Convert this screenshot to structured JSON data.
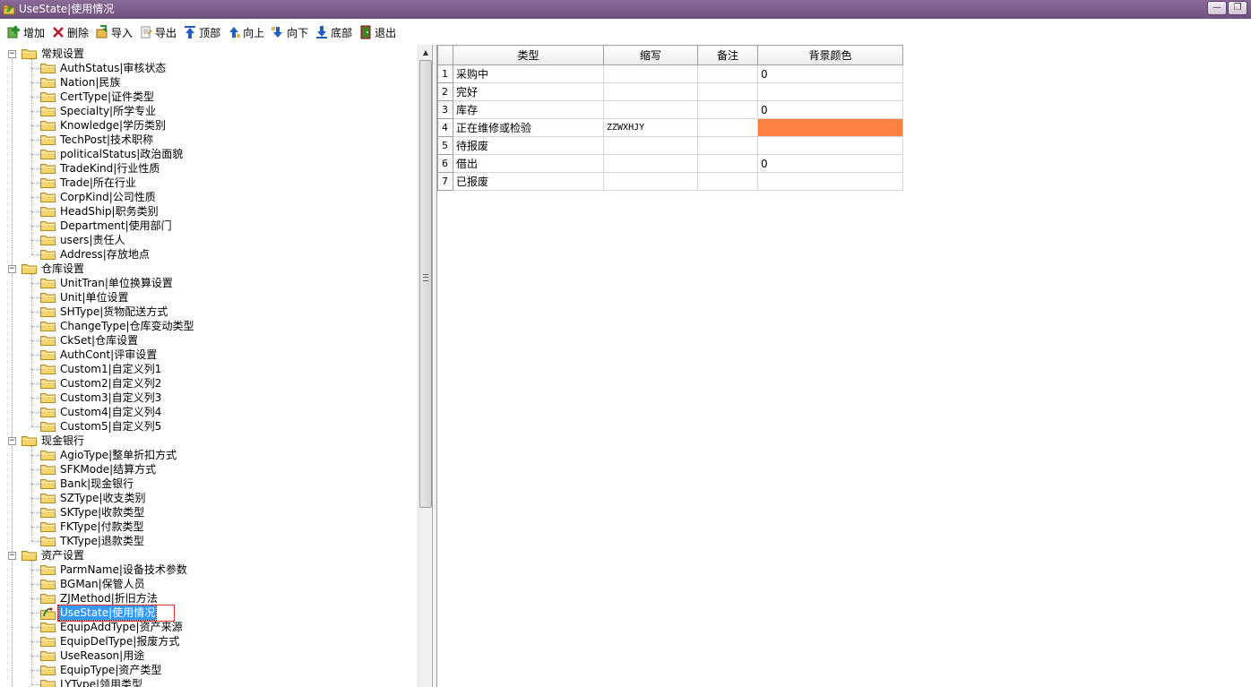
{
  "window": {
    "title": "UseState|使用情况",
    "minimize_glyph": "—",
    "restore_glyph": "❐"
  },
  "toolbar": [
    {
      "id": "add",
      "label": "增加",
      "icon": "add-icon",
      "color": "#2e8b2e"
    },
    {
      "id": "delete",
      "label": "删除",
      "icon": "delete-x-icon",
      "color": "#c8102e"
    },
    {
      "id": "import",
      "label": "导入",
      "icon": "import-icon",
      "color": "#d89b1c"
    },
    {
      "id": "export",
      "label": "导出",
      "icon": "export-icon",
      "color": "#d89b1c"
    },
    {
      "id": "top",
      "label": "顶部",
      "icon": "move-top-icon",
      "color": "#1f5fbf"
    },
    {
      "id": "up",
      "label": "向上",
      "icon": "move-up-icon",
      "color": "#1f5fbf"
    },
    {
      "id": "down",
      "label": "向下",
      "icon": "move-down-icon",
      "color": "#1f5fbf"
    },
    {
      "id": "bottom",
      "label": "底部",
      "icon": "move-bottom-icon",
      "color": "#1f5fbf"
    },
    {
      "id": "exit",
      "label": "退出",
      "icon": "exit-door-icon",
      "color": "#7a5a2a"
    }
  ],
  "tree": {
    "groups": [
      {
        "label": "常规设置",
        "expander": "−",
        "items": [
          "AuthStatus|审核状态",
          "Nation|民族",
          "CertType|证件类型",
          "Specialty|所学专业",
          "Knowledge|学历类别",
          "TechPost|技术职称",
          "politicalStatus|政治面貌",
          "TradeKind|行业性质",
          "Trade|所在行业",
          "CorpKind|公司性质",
          "HeadShip|职务类别",
          "Department|使用部门",
          "users|责任人",
          "Address|存放地点"
        ]
      },
      {
        "label": "仓库设置",
        "expander": "−",
        "items": [
          "UnitTran|单位换算设置",
          "Unit|单位设置",
          "SHType|货物配送方式",
          "ChangeType|仓库变动类型",
          "CkSet|仓库设置",
          "AuthCont|评审设置",
          "Custom1|自定义列1",
          "Custom2|自定义列2",
          "Custom3|自定义列3",
          "Custom4|自定义列4",
          "Custom5|自定义列5"
        ]
      },
      {
        "label": "现金银行",
        "expander": "−",
        "items": [
          "AgioType|整单折扣方式",
          "SFKMode|结算方式",
          "Bank|现金银行",
          "SZType|收支类别",
          "SKType|收款类型",
          "FKType|付款类型",
          "TKType|退款类型"
        ]
      },
      {
        "label": "资产设置",
        "expander": "−",
        "items": [
          "ParmName|设备技术参数",
          "BGMan|保管人员",
          "ZJMethod|折旧方法",
          "UseState|使用情况",
          "EquipAddType|资产来源",
          "EquipDelType|报废方式",
          "UseReason|用途",
          "EquipType|资产类型",
          "LYType|领用类型"
        ]
      }
    ],
    "selected": "UseState|使用情况"
  },
  "grid": {
    "columns": [
      "类型",
      "缩写",
      "备注",
      "背景颜色"
    ],
    "rows": [
      {
        "num": "1",
        "type": "采购中",
        "abbr": "",
        "note": "",
        "color_text": "0",
        "color_fill": ""
      },
      {
        "num": "2",
        "type": "完好",
        "abbr": "",
        "note": "",
        "color_text": "",
        "color_fill": ""
      },
      {
        "num": "3",
        "type": "库存",
        "abbr": "",
        "note": "",
        "color_text": "0",
        "color_fill": ""
      },
      {
        "num": "4",
        "type": "正在维修或检验",
        "abbr": "ZZWXHJY",
        "note": "",
        "color_text": "",
        "color_fill": "#ff8040"
      },
      {
        "num": "5",
        "type": "待报废",
        "abbr": "",
        "note": "",
        "color_text": "",
        "color_fill": ""
      },
      {
        "num": "6",
        "type": "借出",
        "abbr": "",
        "note": "",
        "color_text": "0",
        "color_fill": ""
      },
      {
        "num": "7",
        "type": "已报废",
        "abbr": "",
        "note": "",
        "color_text": "",
        "color_fill": ""
      }
    ]
  },
  "colors": {
    "titlebar": "#7b5a8a",
    "selection": "#3399ff",
    "selection_box": "#e03030",
    "folder": "#f5d36b"
  }
}
